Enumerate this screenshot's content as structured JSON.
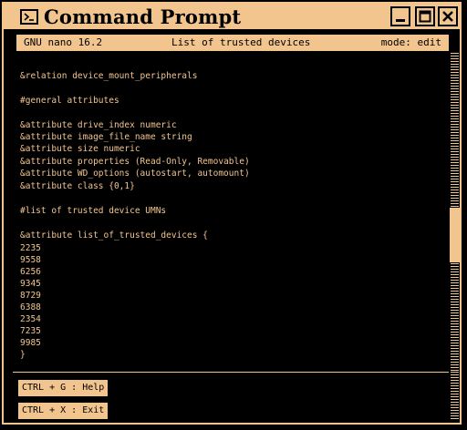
{
  "window": {
    "title": "Command Prompt",
    "colors": {
      "accent": "#f2c58f",
      "background": "#000000"
    }
  },
  "nano": {
    "version": "GNU nano 16.2",
    "file_title": "List of trusted devices",
    "mode": "mode: edit"
  },
  "editor": {
    "lines": [
      "&relation device_mount_peripherals",
      "#general attributes",
      "&attribute drive_index numeric",
      "&attribute image_file_name string",
      "&attribute size numeric",
      "&attribute properties (Read-Only, Removable)",
      "&attribute WD_options (autostart, automount)",
      "&attribute class {0,1}",
      "#list of trusted device UMNs",
      "&attribute list_of_trusted_devices {",
      "2235",
      "9558",
      "6256",
      "9345",
      "8729",
      "6388",
      "2354",
      "7235",
      "9985",
      "}"
    ]
  },
  "shortcuts": [
    {
      "label": "CTRL + G : Help"
    },
    {
      "label": "CTRL + X : Exit"
    }
  ]
}
